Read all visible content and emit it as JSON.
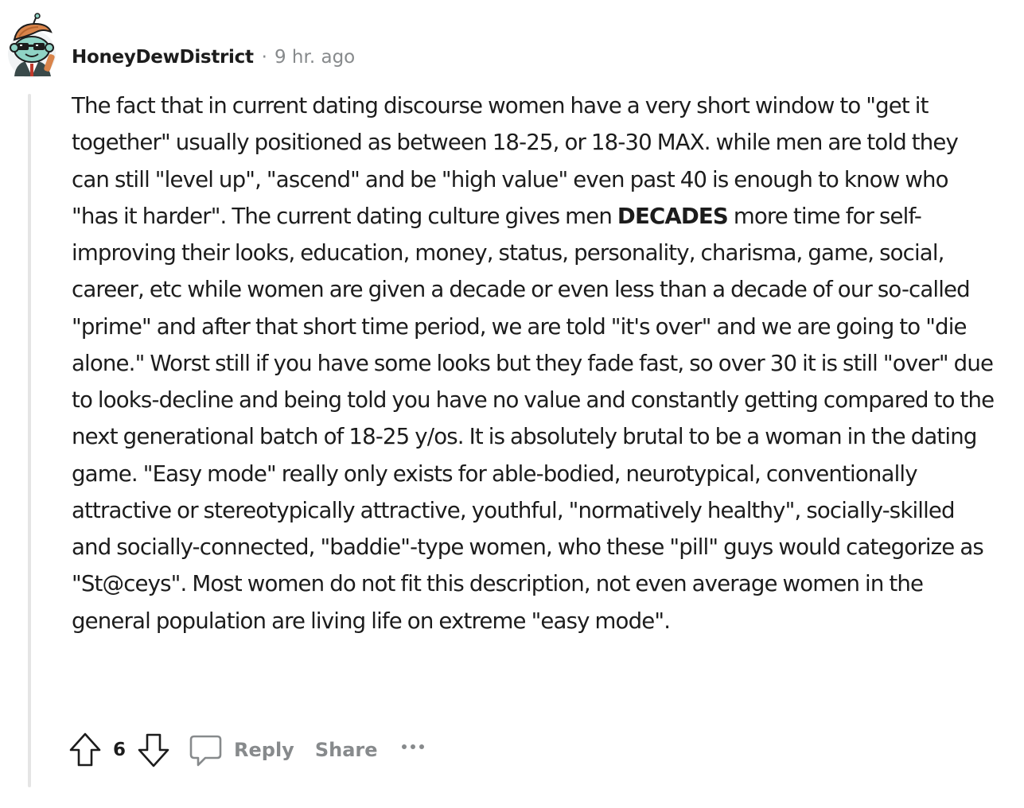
{
  "comment": {
    "username": "HoneyDewDistrict",
    "separator": "·",
    "timestamp": "9 hr. ago",
    "avatar_icon": "snoo-avatar-sunglasses-icon",
    "body": {
      "part1": "The fact that in current dating discourse women have a very short window to \"get it together\" usually positioned as between 18-25, or 18-30 MAX. while men are told they can still \"level up\", \"ascend\" and be \"high value\" even past 40 is enough to know who \"has it harder\". The current dating culture gives men ",
      "emphasis": "DECADES",
      "part2": " more time for self-improving their looks, education, money, status, personality, charisma, game, social, career, etc while women are given a decade or even less than a decade of our so-called \"prime\" and after that short time period, we are told \"it's over\" and we are going to \"die alone.\" Worst still if you have some looks but they fade fast, so over 30 it is still \"over\" due to looks-decline and being told you have no value and constantly getting compared to the next generational batch of 18-25 y/os. It is absolutely brutal to be a woman in the dating game. \"Easy mode\" really only exists for able-bodied, neurotypical, conventionally attractive or stereotypically attractive, youthful, \"normatively healthy\", socially-skilled and socially-connected, \"baddie\"-type women, who these \"pill\" guys would categorize as \"St@ceys\". Most women do not fit this description, not even average women in the general population are living life on extreme \"easy mode\"."
    },
    "actions": {
      "vote_count": "6",
      "upvote_icon": "upvote-arrow-icon",
      "downvote_icon": "downvote-arrow-icon",
      "reply_icon": "comment-bubble-icon",
      "reply_label": "Reply",
      "share_label": "Share",
      "more_icon": "ellipsis-icon"
    }
  },
  "colors": {
    "text": "#1c1c1c",
    "meta": "#878a8c",
    "thread_line": "#e5e5e5",
    "avatar_body": "#8fd3c5",
    "avatar_hair": "#d9844a",
    "avatar_jacket": "#3a4a4a"
  }
}
